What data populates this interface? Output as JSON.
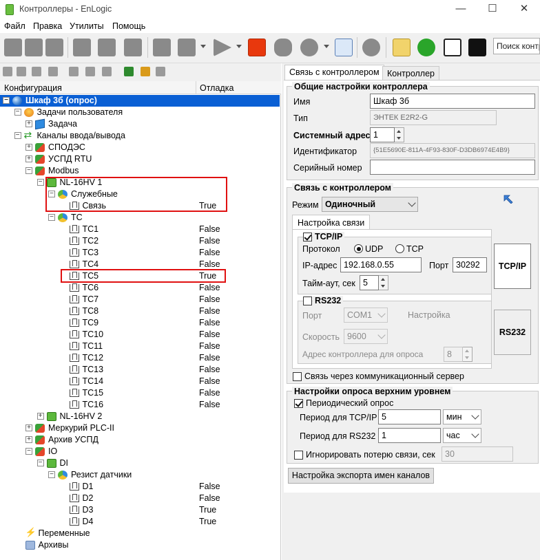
{
  "window": {
    "title": "Контроллеры - EnLogic",
    "min": "—",
    "max": "☐",
    "close": "✕"
  },
  "menu": [
    "Файл",
    "Правка",
    "Утилиты",
    "Помощь"
  ],
  "toolbar": {
    "search_placeholder": "Поиск контр"
  },
  "tree": {
    "header": {
      "config": "Конфигурация",
      "debug": "Отладка"
    },
    "rows": [
      {
        "label": "Шкаф 3б (опрос)",
        "value": ""
      },
      {
        "label": "Задачи пользователя",
        "value": ""
      },
      {
        "label": "Задача",
        "value": ""
      },
      {
        "label": "Каналы ввода/вывода",
        "value": ""
      },
      {
        "label": "СПОДЭС",
        "value": ""
      },
      {
        "label": "УСПД RTU",
        "value": ""
      },
      {
        "label": "Modbus",
        "value": ""
      },
      {
        "label": "NL-16HV 1",
        "value": ""
      },
      {
        "label": "Служебные",
        "value": ""
      },
      {
        "label": "Связь",
        "value": "True"
      },
      {
        "label": "TC",
        "value": ""
      },
      {
        "label": "TC1",
        "value": "False"
      },
      {
        "label": "TC2",
        "value": "False"
      },
      {
        "label": "TC3",
        "value": "False"
      },
      {
        "label": "TC4",
        "value": "False"
      },
      {
        "label": "TC5",
        "value": "True"
      },
      {
        "label": "TC6",
        "value": "False"
      },
      {
        "label": "TC7",
        "value": "False"
      },
      {
        "label": "TC8",
        "value": "False"
      },
      {
        "label": "TC9",
        "value": "False"
      },
      {
        "label": "TC10",
        "value": "False"
      },
      {
        "label": "TC11",
        "value": "False"
      },
      {
        "label": "TC12",
        "value": "False"
      },
      {
        "label": "TC13",
        "value": "False"
      },
      {
        "label": "TC14",
        "value": "False"
      },
      {
        "label": "TC15",
        "value": "False"
      },
      {
        "label": "TC16",
        "value": "False"
      },
      {
        "label": "NL-16HV 2",
        "value": ""
      },
      {
        "label": "Меркурий PLC-II",
        "value": ""
      },
      {
        "label": "Архив УСПД",
        "value": ""
      },
      {
        "label": "IO",
        "value": ""
      },
      {
        "label": "DI",
        "value": ""
      },
      {
        "label": "Резист датчики",
        "value": ""
      },
      {
        "label": "D1",
        "value": "False"
      },
      {
        "label": "D2",
        "value": "False"
      },
      {
        "label": "D3",
        "value": "True"
      },
      {
        "label": "D4",
        "value": "True"
      },
      {
        "label": "Переменные",
        "value": ""
      },
      {
        "label": "Архивы",
        "value": ""
      }
    ]
  },
  "tabs": {
    "connection": "Связь с контроллером",
    "controller": "Контроллер"
  },
  "general": {
    "title": "Общие настройки контроллера",
    "name_label": "Имя",
    "name_value": "Шкаф 3б",
    "type_label": "Тип",
    "type_value": "ЭНТЕК E2R2-G",
    "sysaddr_label": "Системный адрес",
    "sysaddr_value": "1",
    "id_label": "Идентификатор",
    "id_value": "{51E5690E-811A-4F93-830F-D3DB6974E4B9}",
    "serial_label": "Серийный номер",
    "serial_value": ""
  },
  "connection": {
    "title": "Связь с контроллером",
    "mode_label": "Режим",
    "mode_value": "Одиночный",
    "subtab": "Настройка связи",
    "tcpip": {
      "label": "TCP/IP",
      "protocol_label": "Протокол",
      "udp": "UDP",
      "tcp": "TCP",
      "ip_label": "IP-адрес",
      "ip_value": "192.168.0.55",
      "port_label": "Порт",
      "port_value": "30292",
      "timeout_label": "Тайм-аут, сек",
      "timeout_value": "5"
    },
    "rs232": {
      "label": "RS232",
      "port_label": "Порт",
      "port_value": "COM1",
      "settings_label": "Настройка",
      "speed_label": "Скорость",
      "speed_value": "9600",
      "addr_label": "Адрес контроллера для опроса",
      "addr_value": "8"
    },
    "btn_tcpip": "TCP/IP",
    "btn_rs232": "RS232",
    "comm_server_label": "Связь через коммуникационный сервер"
  },
  "upper": {
    "title": "Настройки опроса верхним уровнем",
    "periodic_label": "Периодический опрос",
    "tcp_period_label": "Период для TCP/IP",
    "tcp_period_value": "5",
    "tcp_unit": "мин",
    "rs_period_label": "Период для RS232",
    "rs_period_value": "1",
    "rs_unit": "час",
    "ignore_label": "Игнорировать потерю связи, сек",
    "ignore_value": "30"
  },
  "export_button": "Настройка экспорта имен каналов"
}
